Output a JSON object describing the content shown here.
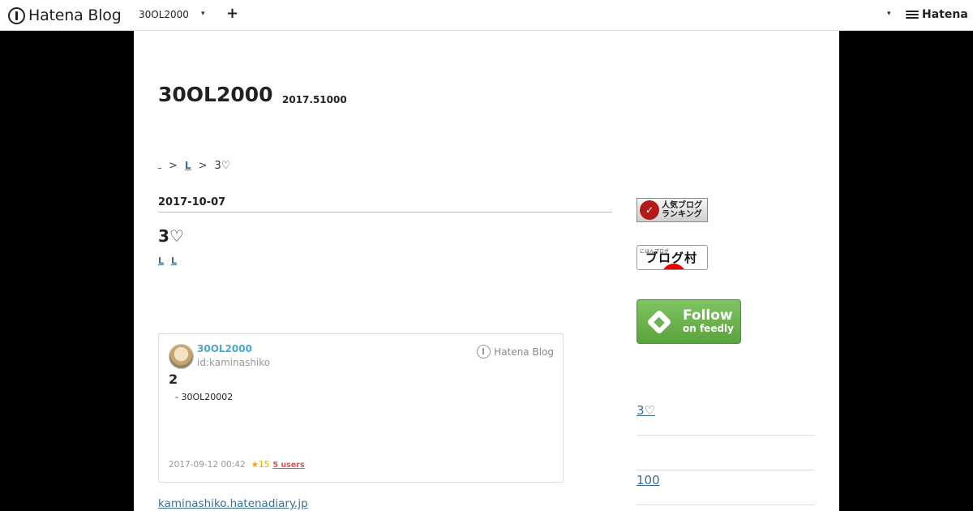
{
  "header": {
    "logo_text": "Hatena Blog",
    "blog_name": "30OL2000",
    "caret": "▾",
    "add_label": "+",
    "hatena_label": "Hatena"
  },
  "blog": {
    "title": "30OL2000",
    "description": "2017.51000"
  },
  "breadcrumb": {
    "items": [
      "",
      "L",
      "3♡"
    ],
    "separator": ">"
  },
  "entry": {
    "date": "2017-10-07",
    "title": "3♡",
    "categories": [
      "L",
      "L"
    ],
    "link_text": "kaminashiko.hatenadiary.jp"
  },
  "embed": {
    "author_name": "30OL2000",
    "author_id": "id:kaminashiko",
    "brand": "Hatena Blog",
    "title": "2",
    "snippet": "- 30OL20002",
    "date": "2017-09-12 00:42",
    "stars": "★15",
    "users": "5 users"
  },
  "sidebar": {
    "ninki_label_1": "人気ブログ",
    "ninki_label_2": "ランキング",
    "mura_small": "にほんブログ",
    "mura_big": "ブログ村",
    "feedly_line1": "Follow",
    "feedly_line2": "on feedly",
    "links": [
      "3♡",
      "100"
    ]
  },
  "colors": {
    "link": "#3b6e95",
    "author": "#4aa8c9",
    "stars": "#f0a800",
    "users": "#e94b4b",
    "feedly": "#6cb24e"
  }
}
